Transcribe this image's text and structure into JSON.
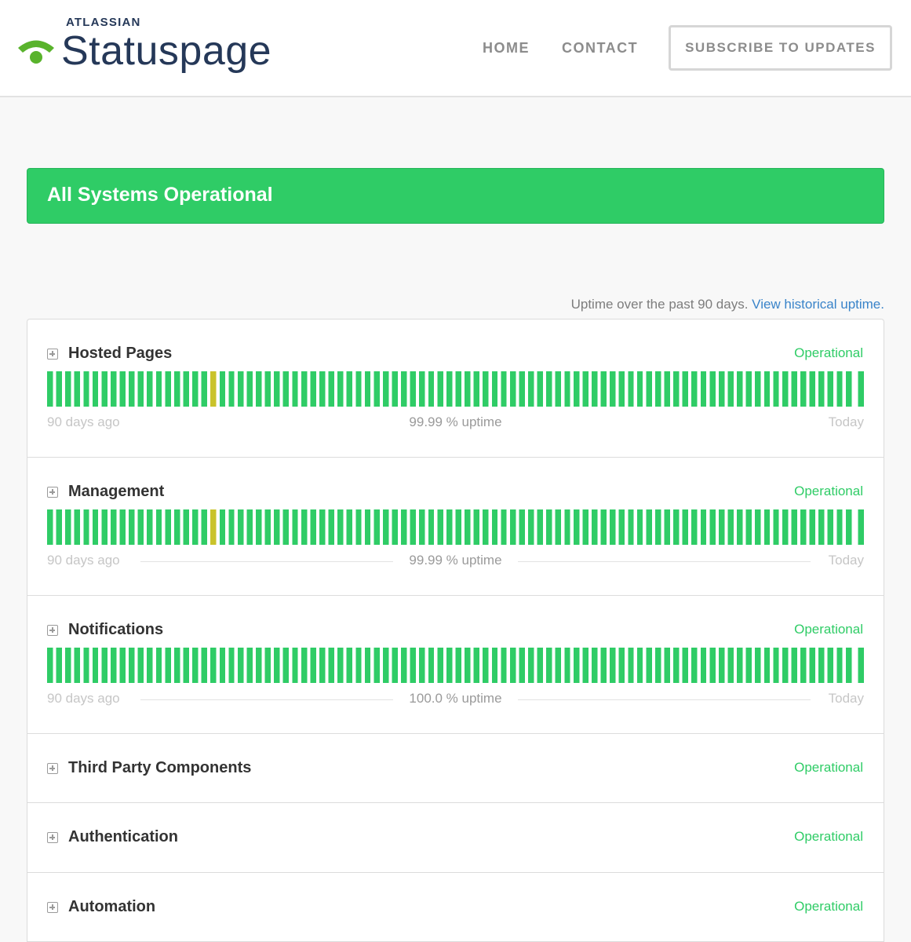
{
  "header": {
    "brand_company": "ATLASSIAN",
    "brand_product": "Statuspage",
    "nav": {
      "home": "HOME",
      "contact": "CONTACT"
    },
    "subscribe_label": "SUBSCRIBE TO UPDATES",
    "logo_icon": "statuspage-logo-icon"
  },
  "banner": {
    "text": "All Systems Operational",
    "color": "#2fcc66"
  },
  "uptime_note": {
    "text": "Uptime over the past 90 days.",
    "link": "View historical uptime."
  },
  "colors": {
    "operational": "#2fcc66",
    "degraded": "#c9c32a"
  },
  "legend": {
    "start": "90 days ago",
    "end": "Today"
  },
  "components": [
    {
      "name": "Hosted Pages",
      "status": "Operational",
      "uptime": "99.99 % uptime",
      "days": 90,
      "degraded_days": [
        18
      ]
    },
    {
      "name": "Management",
      "status": "Operational",
      "uptime": "99.99 % uptime",
      "days": 90,
      "degraded_days": [
        18
      ]
    },
    {
      "name": "Notifications",
      "status": "Operational",
      "uptime": "100.0 % uptime",
      "days": 90,
      "degraded_days": []
    },
    {
      "name": "Third Party Components",
      "status": "Operational"
    },
    {
      "name": "Authentication",
      "status": "Operational"
    },
    {
      "name": "Automation",
      "status": "Operational"
    }
  ]
}
